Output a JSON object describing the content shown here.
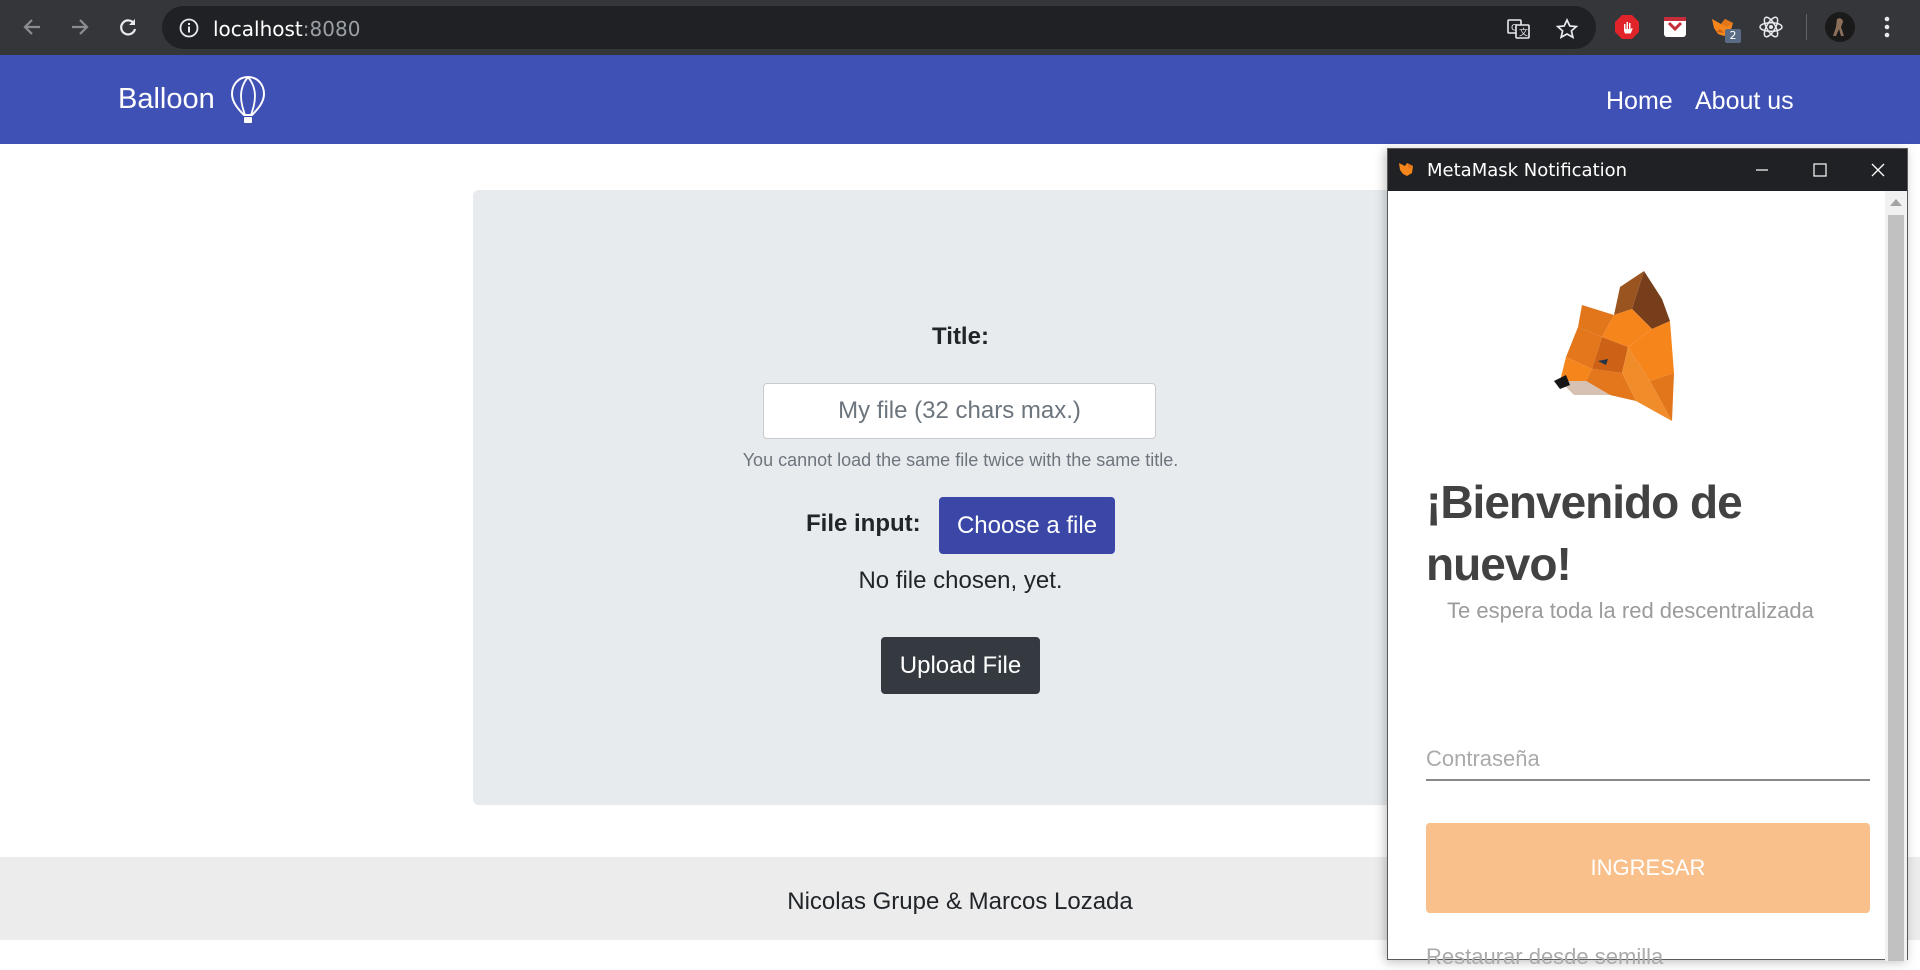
{
  "browser": {
    "url_host": "localhost",
    "url_port": ":8080",
    "extension_badge": "2"
  },
  "app": {
    "brand": "Balloon",
    "nav": [
      {
        "label": "Home"
      },
      {
        "label": "About us"
      }
    ]
  },
  "upload_form": {
    "title_label": "Title:",
    "title_placeholder": "My file (32 chars max.)",
    "hint": "You cannot load the same file twice with the same title.",
    "file_label": "File input:",
    "choose_button": "Choose a file",
    "file_status": "No file chosen, yet.",
    "upload_button": "Upload File"
  },
  "footer": {
    "text": "Nicolas Grupe & Marcos Lozada"
  },
  "metamask": {
    "window_title": "MetaMask Notification",
    "heading": "¡Bienvenido de nuevo!",
    "subheading": "Te espera toda la red descentralizada",
    "password_placeholder": "Contraseña",
    "login_button": "INGRESAR",
    "restore_link": "Restaurar desde semilla"
  },
  "colors": {
    "header": "#3f51b5",
    "choose_button": "#3a47a7",
    "upload_button": "#343a40",
    "metamask_button": "#f9c08b"
  }
}
